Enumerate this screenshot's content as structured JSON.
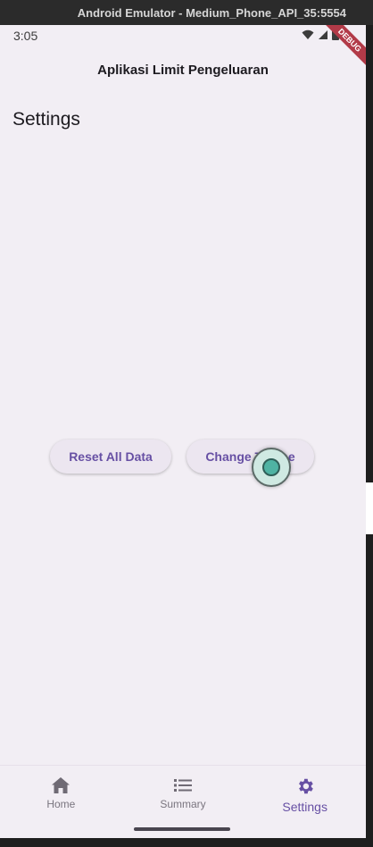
{
  "window": {
    "title": "Android Emulator - Medium_Phone_API_35:5554"
  },
  "status_bar": {
    "time": "3:05",
    "debug_label": "DEBUG"
  },
  "app_bar": {
    "title": "Aplikasi Limit Pengeluaran"
  },
  "page": {
    "heading": "Settings"
  },
  "buttons": {
    "reset": "Reset All Data",
    "theme": "Change Theme"
  },
  "bottom_nav": {
    "items": [
      {
        "label": "Home",
        "icon": "home-icon"
      },
      {
        "label": "Summary",
        "icon": "list-icon"
      },
      {
        "label": "Settings",
        "icon": "gear-icon",
        "active": true
      }
    ]
  },
  "colors": {
    "accent": "#6750a4",
    "background": "#f2eef4",
    "debug": "#b23a48"
  }
}
